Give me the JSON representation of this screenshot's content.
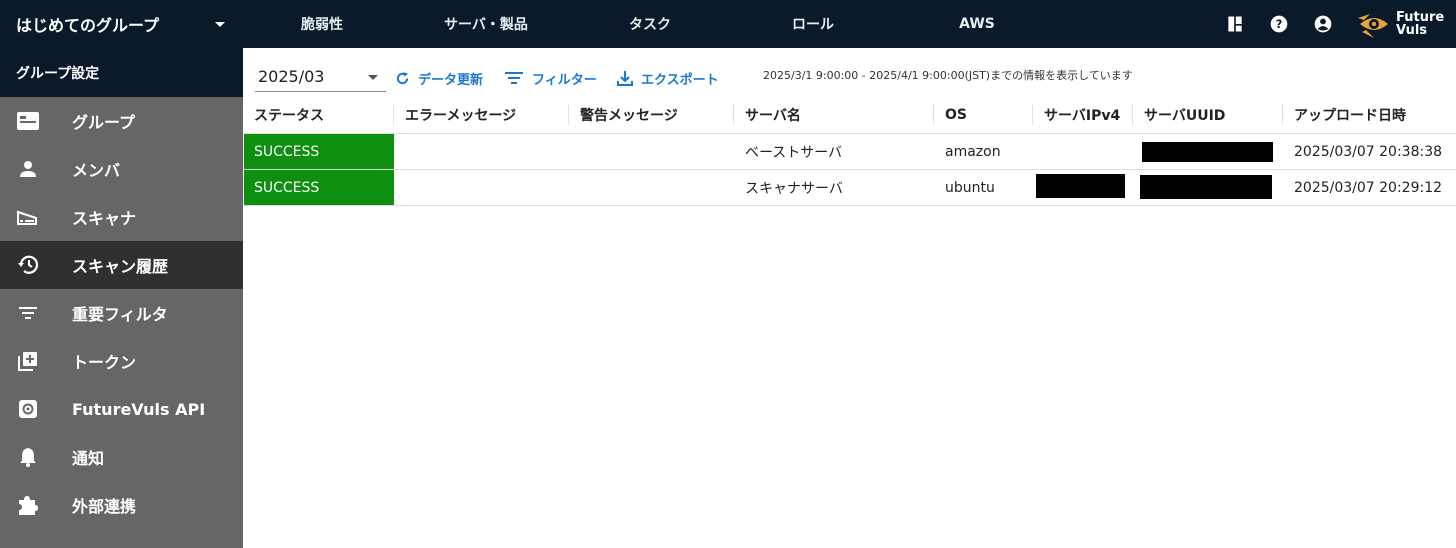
{
  "header": {
    "group_name": "はじめてのグループ",
    "nav": [
      "脆弱性",
      "サーバ・製品",
      "タスク",
      "ロール",
      "AWS"
    ],
    "icons": [
      "dashboard-icon",
      "help-icon",
      "account-icon"
    ],
    "logo_line1": "Future",
    "logo_line2": "Vuls",
    "logo_color": "#e8a33a"
  },
  "sidebar": {
    "title": "グループ設定",
    "items": [
      {
        "label": "グループ",
        "icon": "group-card-icon",
        "active": false
      },
      {
        "label": "メンバ",
        "icon": "person-icon",
        "active": false
      },
      {
        "label": "スキャナ",
        "icon": "scanner-icon",
        "active": false
      },
      {
        "label": "スキャン履歴",
        "icon": "history-icon",
        "active": true
      },
      {
        "label": "重要フィルタ",
        "icon": "filter-icon",
        "active": false
      },
      {
        "label": "トークン",
        "icon": "add-token-icon",
        "active": false
      },
      {
        "label": "FutureVuls API",
        "icon": "api-gear-icon",
        "active": false
      },
      {
        "label": "通知",
        "icon": "bell-icon",
        "active": false
      },
      {
        "label": "外部連携",
        "icon": "puzzle-icon",
        "active": false
      }
    ]
  },
  "toolbar": {
    "month_value": "2025/03",
    "refresh_label": "データ更新",
    "filter_label": "フィルター",
    "export_label": "エクスポート",
    "range_text": "2025/3/1 9:00:00 - 2025/4/1 9:00:00(JST)までの情報を表示しています",
    "accent_color": "#1976d2"
  },
  "table": {
    "columns": [
      "ステータス",
      "エラーメッセージ",
      "警告メッセージ",
      "サーバ名",
      "OS",
      "サーバIPv4",
      "サーバUUID",
      "アップロード日時"
    ],
    "rows": [
      {
        "status": "SUCCESS",
        "error": "",
        "warning": "",
        "server": "ベーストサーバ",
        "os": "amazon",
        "ipv4": "",
        "uuid": "",
        "uploaded": "2025/03/07 20:38:38"
      },
      {
        "status": "SUCCESS",
        "error": "",
        "warning": "",
        "server": "スキャナサーバ",
        "os": "ubuntu",
        "ipv4": "",
        "uuid": "",
        "uploaded": "2025/03/07 20:29:12"
      }
    ],
    "status_color": "#0f8f0f"
  }
}
